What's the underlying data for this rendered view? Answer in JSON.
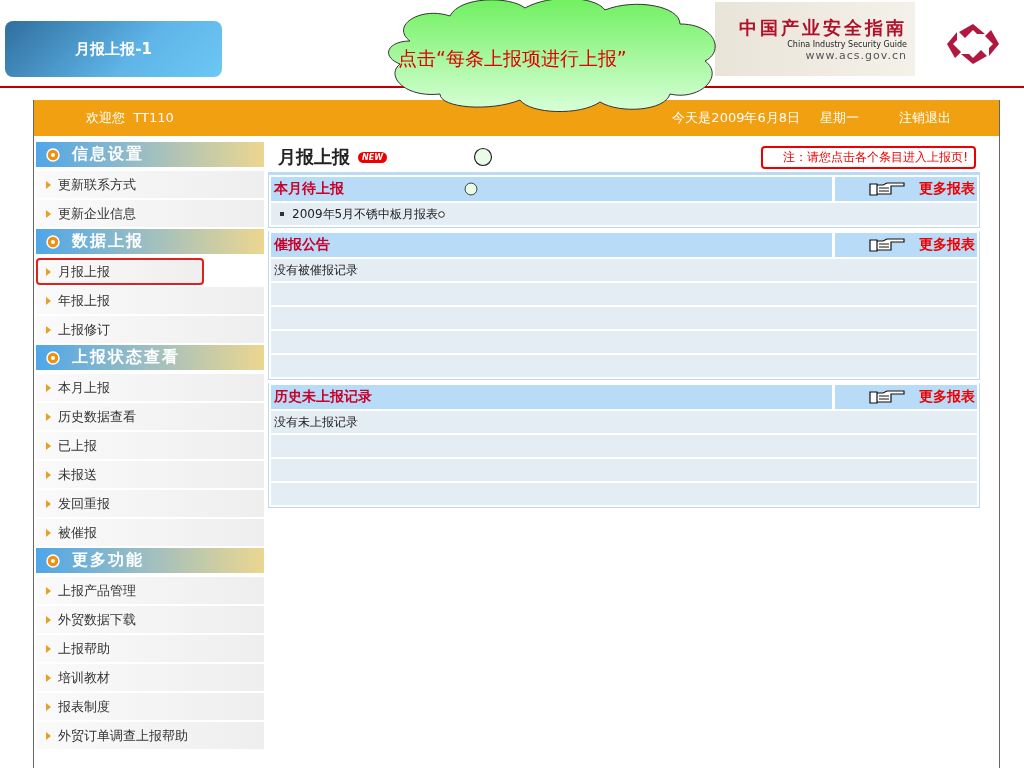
{
  "slide": {
    "title": "月报上报-1",
    "callout": "点击“每条上报项进行上报”",
    "banner": {
      "title": "中国产业安全指南",
      "subtitle": "China Industry Security Guide",
      "url": "www.acs.gov.cn"
    }
  },
  "topbar": {
    "welcome": "欢迎您  TT110",
    "date": "今天是2009年6月8日",
    "weekday": "星期一",
    "logout": "注销退出"
  },
  "sidebar": {
    "groups": [
      {
        "title": "信息设置",
        "items": [
          {
            "label": "更新联系方式",
            "selected": false
          },
          {
            "label": "更新企业信息",
            "selected": false
          }
        ]
      },
      {
        "title": "数据上报",
        "items": [
          {
            "label": "月报上报",
            "selected": true
          },
          {
            "label": "年报上报",
            "selected": false
          },
          {
            "label": "上报修订",
            "selected": false
          }
        ]
      },
      {
        "title": "上报状态查看",
        "items": [
          {
            "label": "本月上报",
            "selected": false
          },
          {
            "label": "历史数据查看",
            "selected": false
          },
          {
            "label": "已上报",
            "selected": false
          },
          {
            "label": "未报送",
            "selected": false
          },
          {
            "label": "发回重报",
            "selected": false
          },
          {
            "label": "被催报",
            "selected": false
          }
        ]
      },
      {
        "title": "更多功能",
        "items": [
          {
            "label": "上报产品管理",
            "selected": false
          },
          {
            "label": "外贸数据下载",
            "selected": false
          },
          {
            "label": "上报帮助",
            "selected": false
          },
          {
            "label": "培训教材",
            "selected": false
          },
          {
            "label": "报表制度",
            "selected": false
          },
          {
            "label": "外贸订单调查上报帮助",
            "selected": false
          }
        ]
      }
    ]
  },
  "main": {
    "title": "月报上报",
    "badge": "NEW",
    "note": "注：请您点击各个条目进入上报页!",
    "sections": [
      {
        "title": "本月待上报",
        "more": "更多报表",
        "rows": [
          {
            "kind": "link",
            "text": "2009年5月不锈中板月报表"
          }
        ]
      },
      {
        "title": "催报公告",
        "more": "更多报表",
        "rows": [
          {
            "kind": "plain",
            "text": "没有被催报记录"
          }
        ]
      },
      {
        "title": "历史未上报记录",
        "more": "更多报表",
        "rows": [
          {
            "kind": "plain",
            "text": "没有未上报记录"
          }
        ]
      }
    ]
  }
}
